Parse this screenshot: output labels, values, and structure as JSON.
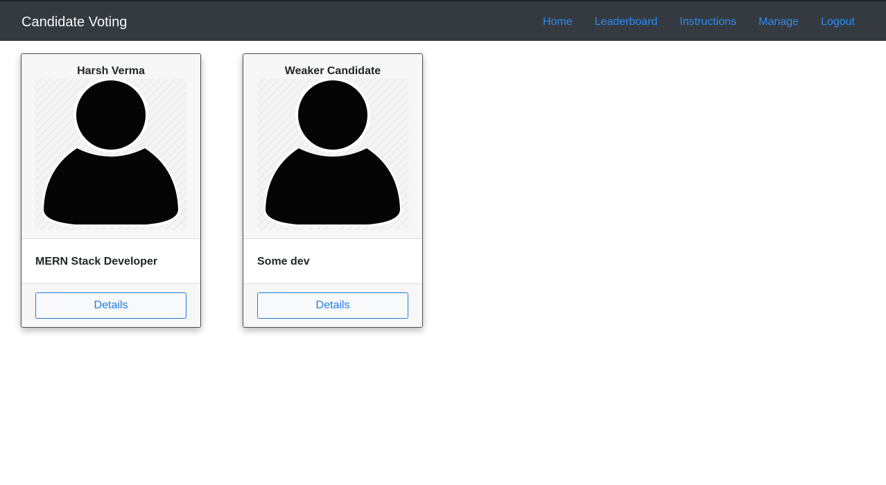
{
  "navbar": {
    "brand": "Candidate Voting",
    "links": [
      "Home",
      "Leaderboard",
      "Instructions",
      "Manage",
      "Logout"
    ]
  },
  "candidates": [
    {
      "name": "Harsh Verma",
      "role": "MERN Stack Developer",
      "button": "Details",
      "avatar_icon": "user-silhouette-icon"
    },
    {
      "name": "Weaker Candidate",
      "role": "Some dev",
      "button": "Details",
      "avatar_icon": "user-silhouette-icon"
    }
  ],
  "colors": {
    "navbar_bg": "#343a40",
    "link": "#2f8cf0",
    "button_border": "#1f7ae0"
  }
}
